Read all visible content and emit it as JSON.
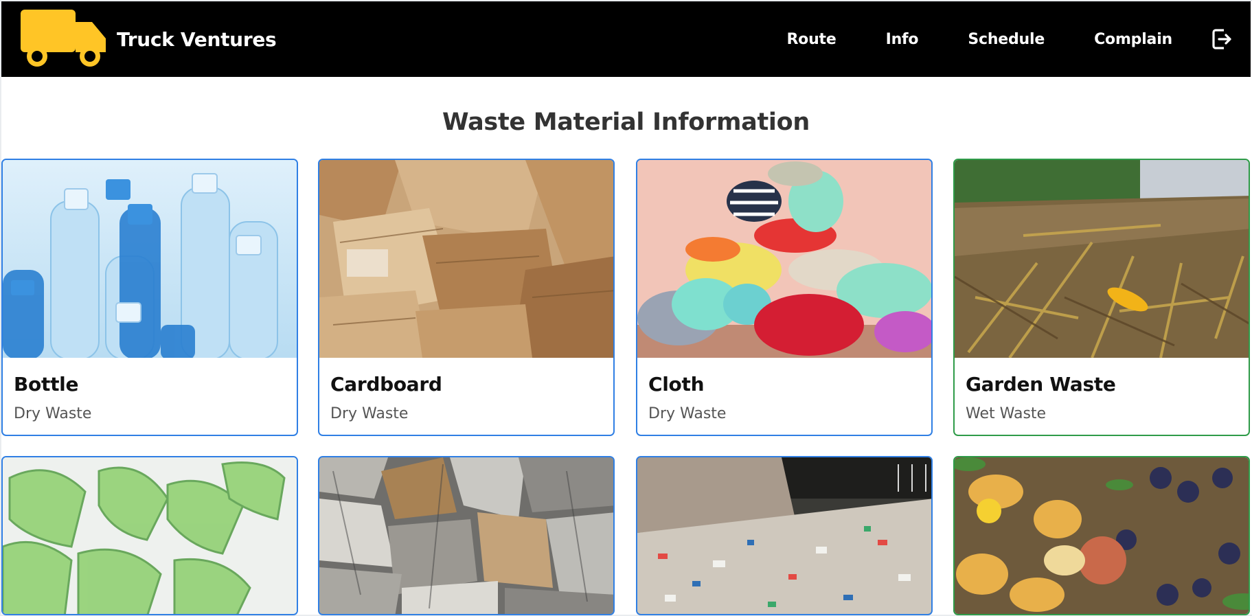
{
  "brand": {
    "name": "Truck Ventures",
    "logo_icon": "truck-icon",
    "logo_color": "#ffc526"
  },
  "nav": {
    "items": [
      "Route",
      "Info",
      "Schedule",
      "Complain"
    ],
    "logout_icon": "logout-icon"
  },
  "page": {
    "title": "Waste Material Information"
  },
  "cards": [
    {
      "name": "Bottle",
      "type": "Dry Waste",
      "accent": "#2f7fe4"
    },
    {
      "name": "Cardboard",
      "type": "Dry Waste",
      "accent": "#2f7fe4"
    },
    {
      "name": "Cloth",
      "type": "Dry Waste",
      "accent": "#2f7fe4"
    },
    {
      "name": "Garden Waste",
      "type": "Wet Waste",
      "accent": "#2e9b48"
    }
  ],
  "cards_row2": [
    {
      "image": "glass-image",
      "accent": "#2f7fe4"
    },
    {
      "image": "metal-image",
      "accent": "#2f7fe4"
    },
    {
      "image": "paper-image",
      "accent": "#2f7fe4"
    },
    {
      "image": "food-waste-image",
      "accent": "#2e9b48"
    }
  ]
}
